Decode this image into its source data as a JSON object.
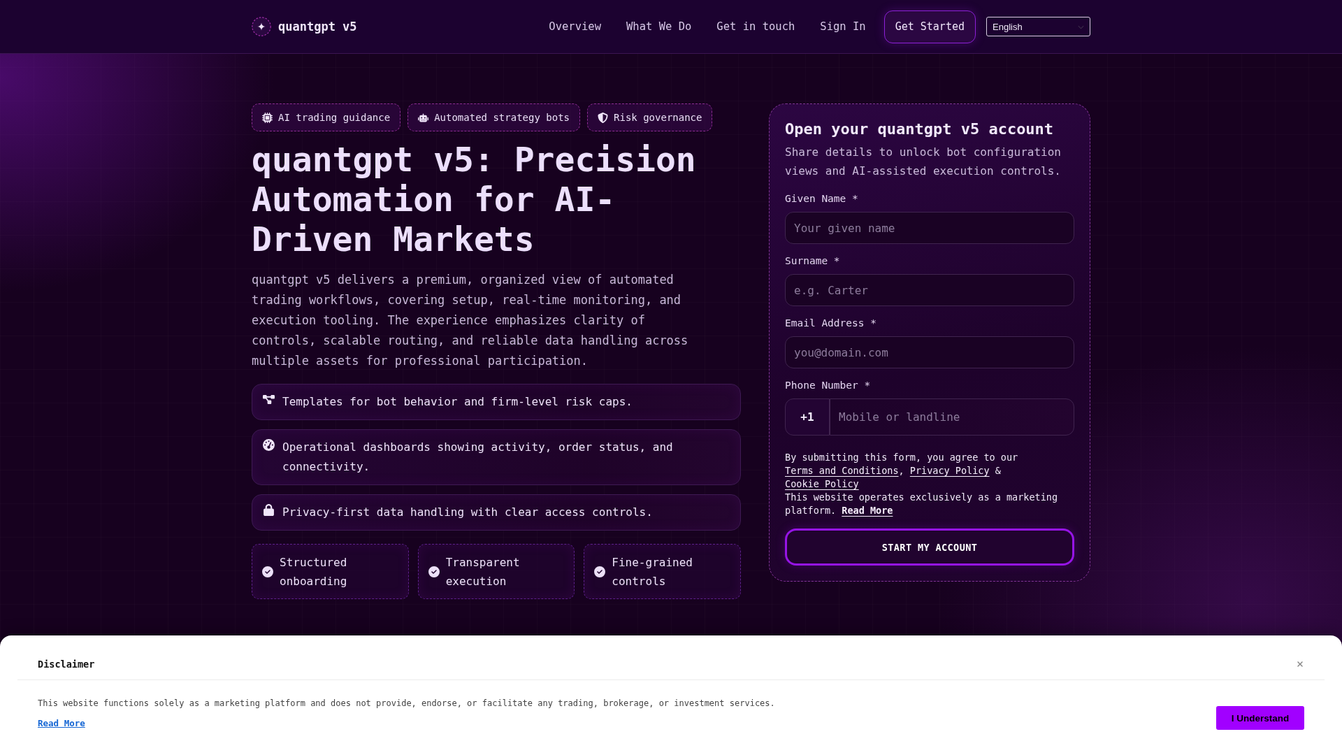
{
  "header": {
    "logo": "quantgpt v5",
    "nav": [
      {
        "label": "Overview"
      },
      {
        "label": "What We Do"
      },
      {
        "label": "Get in touch"
      },
      {
        "label": "Sign In"
      }
    ],
    "cta": "Get Started",
    "language": "English"
  },
  "hero": {
    "chips": [
      "AI trading guidance",
      "Automated strategy bots",
      "Risk governance"
    ],
    "title": "quantgpt v5: Precision Automation for AI-Driven Markets",
    "intro": "quantgpt v5 delivers a premium, organized view of automated trading workflows, covering setup, real-time monitoring, and execution tooling. The experience emphasizes clarity of controls, scalable routing, and reliable data handling across multiple assets for professional participation.",
    "features": [
      "Templates for bot behavior and firm-level risk caps.",
      "Operational dashboards showing activity, order status, and connectivity.",
      "Privacy-first data handling with clear access controls."
    ],
    "highlights": [
      "Structured onboarding",
      "Transparent execution",
      "Fine-grained controls"
    ]
  },
  "signup_form": {
    "title": "Open your quantgpt v5 account",
    "subtitle": "Share details to unlock bot configuration views and AI-assisted execution controls.",
    "fields": [
      {
        "kind": "text",
        "label": "Given Name *",
        "placeholder": "Your given name"
      },
      {
        "kind": "text",
        "label": "Surname *",
        "placeholder": "e.g. Carter"
      },
      {
        "kind": "text",
        "label": "Email Address *",
        "placeholder": "you@domain.com"
      },
      {
        "kind": "phone",
        "label": "Phone Number *",
        "prefix": "+1",
        "placeholder": "Mobile or landline"
      }
    ],
    "consent": [
      {
        "kind": "text",
        "text": "By submitting this form, you agree to our "
      },
      {
        "kind": "link",
        "text": "Terms and Conditions"
      },
      {
        "kind": "text",
        "text": ", "
      },
      {
        "kind": "link",
        "text": "Privacy Policy"
      },
      {
        "kind": "text",
        "text": " & "
      },
      {
        "kind": "link",
        "text": "Cookie Policy"
      }
    ],
    "notice": [
      {
        "kind": "text",
        "text": "This website operates exclusively as a marketing platform. "
      },
      {
        "kind": "link",
        "text": "Read More"
      }
    ],
    "submit": "START MY ACCOUNT"
  },
  "disclaimer": {
    "title": "Disclaimer",
    "text": "This website functions solely as a marketing platform and does not provide, endorse, or facilitate any trading, brokerage, or investment services.",
    "link": "Read More",
    "button": "I Understand"
  }
}
